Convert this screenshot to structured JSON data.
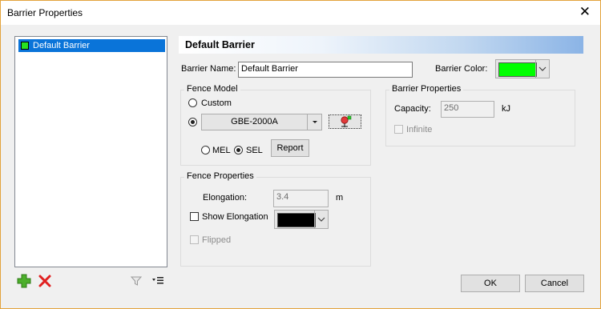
{
  "window": {
    "title": "Barrier Properties",
    "close_icon": "close-icon"
  },
  "tree": {
    "items": [
      {
        "label": "Default Barrier",
        "color": "#27e321"
      }
    ]
  },
  "header": {
    "title": "Default Barrier"
  },
  "barrier": {
    "name_label": "Barrier Name:",
    "name_value": "Default Barrier",
    "color_label": "Barrier Color:",
    "color_value": "#00ff00"
  },
  "fence_model": {
    "title": "Fence Model",
    "custom_label": "Custom",
    "model_value": "GBE-2000A",
    "mel_label": "MEL",
    "sel_label": "SEL",
    "report_label": "Report"
  },
  "barrier_properties": {
    "title": "Barrier Properties",
    "capacity_label": "Capacity:",
    "capacity_value": "250",
    "capacity_unit": "kJ",
    "infinite_label": "Infinite"
  },
  "fence_properties": {
    "title": "Fence Properties",
    "elongation_label": "Elongation:",
    "elongation_value": "3.4",
    "elongation_unit": "m",
    "show_elongation_label": "Show Elongation",
    "show_elongation_color": "#000000",
    "flipped_label": "Flipped"
  },
  "footer": {
    "ok_label": "OK",
    "cancel_label": "Cancel"
  }
}
